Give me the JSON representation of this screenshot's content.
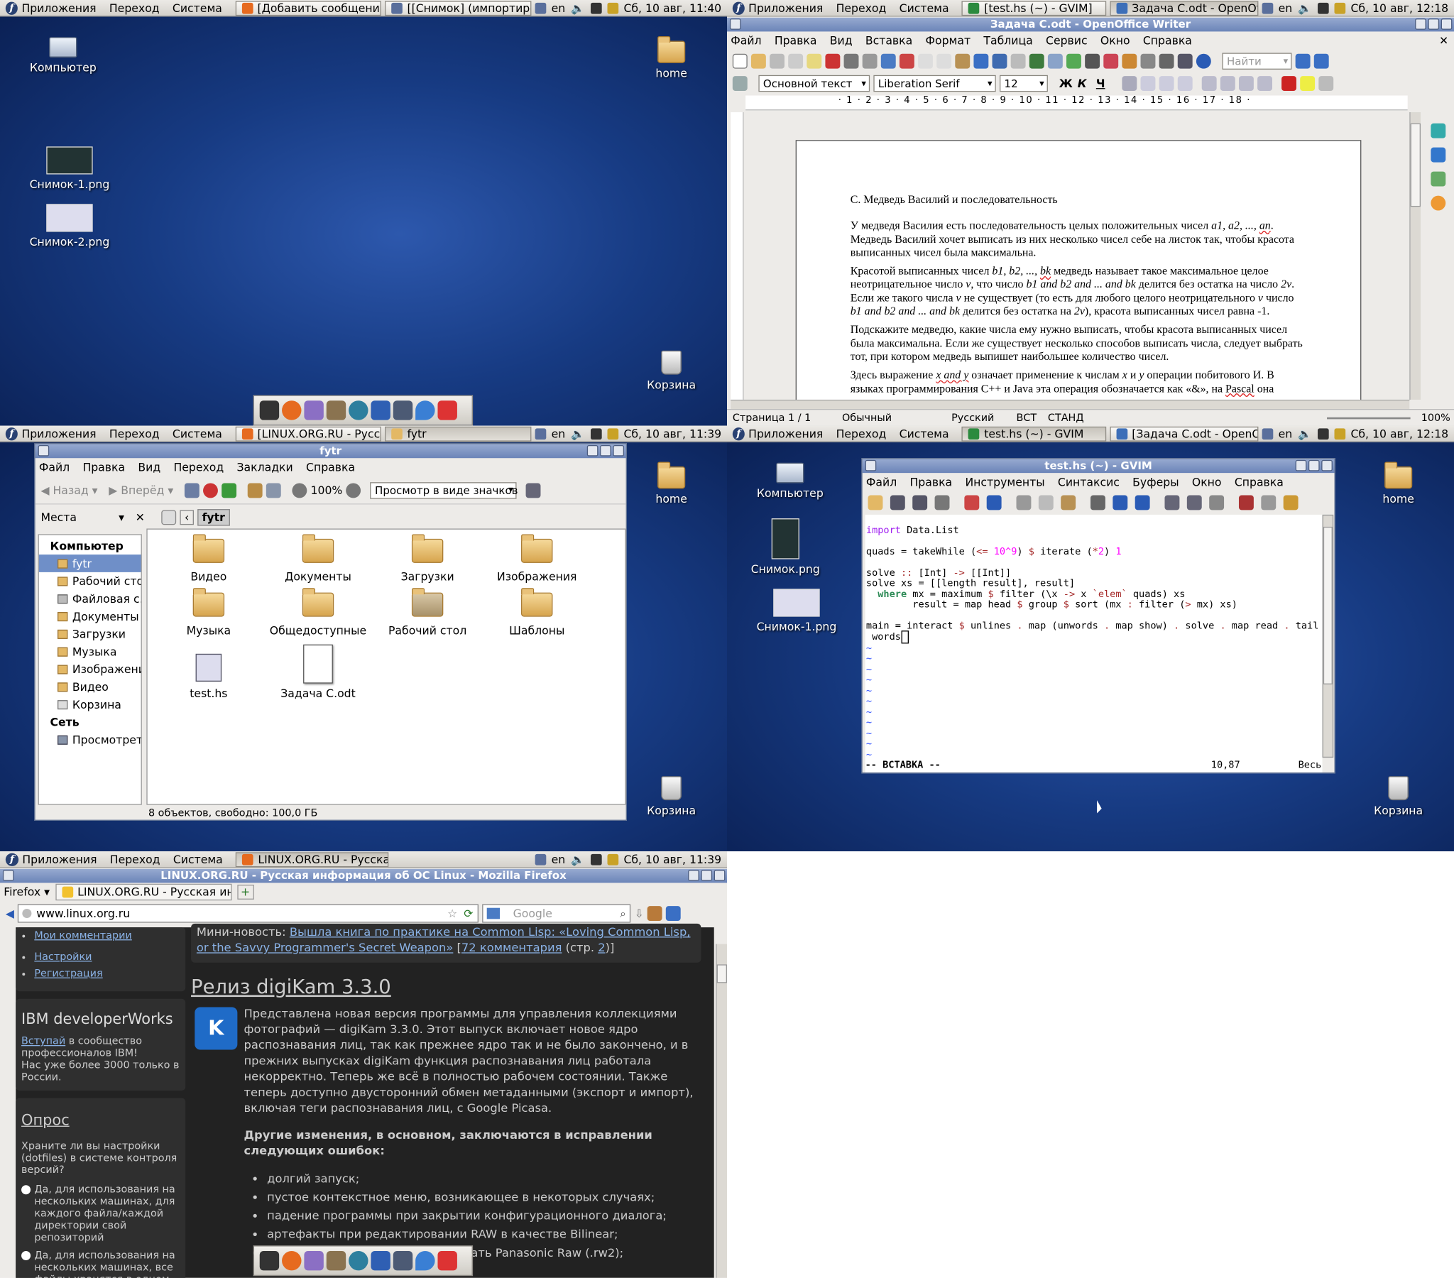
{
  "panel": {
    "applications": "Приложения",
    "places": "Переход",
    "system": "Система",
    "lang": "en"
  },
  "q1": {
    "tasks": [
      "[Добавить сообщение - ...",
      "[[Снимок] (импортирова..."
    ],
    "clock": "Сб, 10 авг, 11:40",
    "icons": [
      "Компьютер",
      "Снимок-1.png",
      "Снимок-2.png",
      "home",
      "Корзина"
    ]
  },
  "q2": {
    "tasks": [
      "[test.hs (~) - GVIM]",
      "Задача C.odt - OpenOffice..."
    ],
    "clock": "Сб, 10 авг, 12:18",
    "title": "Задача C.odt - OpenOffice Writer",
    "menu": [
      "Файл",
      "Правка",
      "Вид",
      "Вставка",
      "Формат",
      "Таблица",
      "Сервис",
      "Окно",
      "Справка"
    ],
    "search_placeholder": "Найти",
    "style": "Основной текст",
    "font": "Liberation Serif",
    "size": "12",
    "fmt": [
      "Ж",
      "К",
      "Ч"
    ],
    "ruler": "· 1 · 2 · 3 · 4 · 5 · 6 · 7 · 8 · 9 · 10 · 11 · 12 · 13 · 14 · 15 · 16 · 17 · 18 ·",
    "doc_title": "C. Медведь Василий и последовательность",
    "p1a": "У медведя Василия есть последовательность целых положительных чисел ",
    "p1_seq": "a1, a2, ..., ",
    "p1_an": "an",
    "p1b": ". Медведь Василий хочет выписать из них несколько чисел себе на листок так, чтобы красота выписанных чисел была максимальна.",
    "p2a": "Красотой выписанных чисел ",
    "p2_seq": "b1, b2, ..., ",
    "p2_bk": "bk",
    "p2b": " медведь называет такое максимальное целое неотрицательное число ",
    "p2_v": "v",
    "p2c": ", что число ",
    "p2_expr1": "b1 and b2 and ... and bk",
    "p2d": " делится без остатка на число ",
    "p2_2v": "2v",
    "p2e": ". Если же такого числа ",
    "p2f": " не существует (то есть для любого целого неотрицательного ",
    "p2g": " число ",
    "p2_expr2": "b1 and b2 and ... and bk",
    "p2h": " делится без остатка на ",
    "p2i": "), красота выписанных чисел равна -1.",
    "p3": "Подскажите медведю, какие числа ему нужно выписать, чтобы красота выписанных чисел была максимальна. Если же существует несколько способов выписать числа, следует выбрать тот, при котором медведь выпишет наибольшее количество чисел.",
    "p4a": "Здесь выражение ",
    "p4_expr": "x and y",
    "p4b": " означает применение к числам ",
    "p4_x": "x",
    "p4c": " и ",
    "p4_y": "y",
    "p4d": " операции побитового И. В языках программирования C++ и Java эта операция обозначается как «&», на ",
    "p4_pascal": "Pascal",
    "p4e": " она",
    "status": [
      "Страница  1 / 1",
      "Обычный",
      "Русский",
      "ВСТ",
      "СТАНД"
    ],
    "zoom": "100%"
  },
  "q3": {
    "tasks": [
      "[LINUX.ORG.RU - Русская ...",
      "fytr"
    ],
    "clock": "Сб, 10 авг, 11:39",
    "title": "fytr",
    "menu": [
      "Файл",
      "Правка",
      "Вид",
      "Переход",
      "Закладки",
      "Справка"
    ],
    "back": "Назад",
    "forward": "Вперёд",
    "zoom": "100%",
    "view": "Просмотр в виде значков",
    "places_label": "Места",
    "crumb": "fytr",
    "side_computer": "Компьютер",
    "side_items": [
      "fytr",
      "Рабочий стол",
      "Файловая с...",
      "Документы",
      "Загрузки",
      "Музыка",
      "Изображения",
      "Видео",
      "Корзина"
    ],
    "side_network": "Сеть",
    "side_browse": "Просмотрет...",
    "files": [
      "Видео",
      "Документы",
      "Загрузки",
      "Изображения",
      "Музыка",
      "Общедоступные",
      "Рабочий стол",
      "Шаблоны",
      "test.hs",
      "Задача C.odt"
    ],
    "status": "8 объектов, свободно: 100,0 ГБ",
    "desk_icons": [
      "home",
      "Корзина"
    ]
  },
  "q4": {
    "tasks": [
      "test.hs (~) - GVIM",
      "[Задача C.odt - OpenOffic..."
    ],
    "clock": "Сб, 10 авг, 12:18",
    "title": "test.hs (~) - GVIM",
    "menu": [
      "Файл",
      "Правка",
      "Инструменты",
      "Синтаксис",
      "Буферы",
      "Окно",
      "Справка"
    ],
    "mode": "-- ВСТАВКА --",
    "pos": "10,87",
    "scroll": "Весь",
    "desk_icons": [
      "Компьютер",
      "Снимок.png",
      "Снимок-1.png",
      "home",
      "Корзина"
    ]
  },
  "q5": {
    "tasks": [
      "LINUX.ORG.RU - Русская ..."
    ],
    "clock": "Сб, 10 авг, 11:39",
    "title": "LINUX.ORG.RU - Русская информация об ОС Linux - Mozilla Firefox",
    "ff_btn": "Firefox",
    "tab": "LINUX.ORG.RU - Русская инфо...",
    "url": "www.linux.org.ru",
    "search_placeholder": "Google",
    "links": [
      "Мои комментарии",
      "Настройки",
      "Регистрация"
    ],
    "ibm_title": "IBM developerWorks",
    "ibm_link": "Вступай",
    "ibm_text1": " в сообщество профессионалов IBM!",
    "ibm_text2": "Нас уже более 3000 только в России.",
    "poll_title": "Опрос",
    "poll_q": "Храните ли вы настройки (dotfiles) в системе контроля версий?",
    "poll_a1": "Да, для использования на нескольких машинах, для каждого файла/каждой директории свой репозиторий",
    "poll_a2": "Да, для использования на нескольких машинах, все файлы хранятся в одном репозитории",
    "mini_label": "Мини-новость: ",
    "mini_link": "Вышла книга по практике на Common Lisp: «Loving Common Lisp, or the Savvy Programmer's Secret Weapon»",
    "mini_comments": "72 комментария",
    "mini_pages_a": " (стр. ",
    "mini_page": "2",
    "mini_pages_b": ")]",
    "headline": "Релиз digiKam 3.3.0",
    "body": "Представлена новая версия программы для управления коллекциями фотографий — digiKam 3.3.0. Этот выпуск включает новое ядро распознавания лиц, так как прежнее ядро так и не было закончено, и в прежних выпусках digiKam функция распознавания лиц работала некорректно. Теперь же всё в полностью рабочем состоянии. Также теперь доступно двусторонний обмен метаданными (экспорт и импорт), включая теги распознавания лиц, с Google Picasa.",
    "changes_title": "Другие изменения, в основном, заключаются в исправлении следующих ошибок:",
    "changes": [
      "долгий запуск;",
      "пустое контекстное меню, возникающее в некоторых случаях;",
      "падение программы при закрытии конфигурационного диалога;",
      "артефакты при редактировании RAW в качестве Bilinear;",
      "падение при попытке декодировать Panasonic Raw (.rw2);"
    ]
  }
}
